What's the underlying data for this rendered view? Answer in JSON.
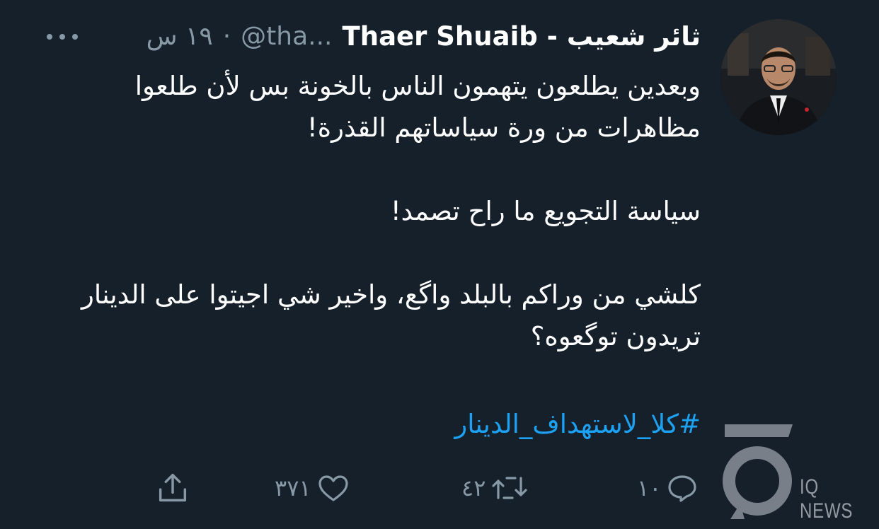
{
  "tweet": {
    "display_name": "ثائر شعيب - Thaer Shuaib",
    "handle": "@tha...",
    "separator": "·",
    "time": "١٩ س",
    "body": [
      "وبعدين يطلعون يتهمون الناس بالخونة بس لأن طلعوا مظاهرات من ورة سياساتهم القذرة!",
      "سياسة التجويع ما راح تصمد!",
      "كلشي من وراكم بالبلد واگع، واخير شي اجيتوا على الدينار تريدون توگعوه؟"
    ],
    "hashtag": "#كلا_لاستهداف_الدينار"
  },
  "actions": {
    "reply_count": "١٠",
    "retweet_count": "٤٢",
    "like_count": "٣٧١",
    "share_label": ""
  },
  "watermark": {
    "text": "IQ NEWS"
  },
  "icons": [
    "avatar-photo",
    "more-icon",
    "reply-icon",
    "retweet-icon",
    "like-icon",
    "share-icon",
    "iq-news-logo"
  ],
  "colors": {
    "background": "#15202b",
    "muted": "#8899a6",
    "link": "#1da1f2",
    "text": "#ffffff"
  }
}
